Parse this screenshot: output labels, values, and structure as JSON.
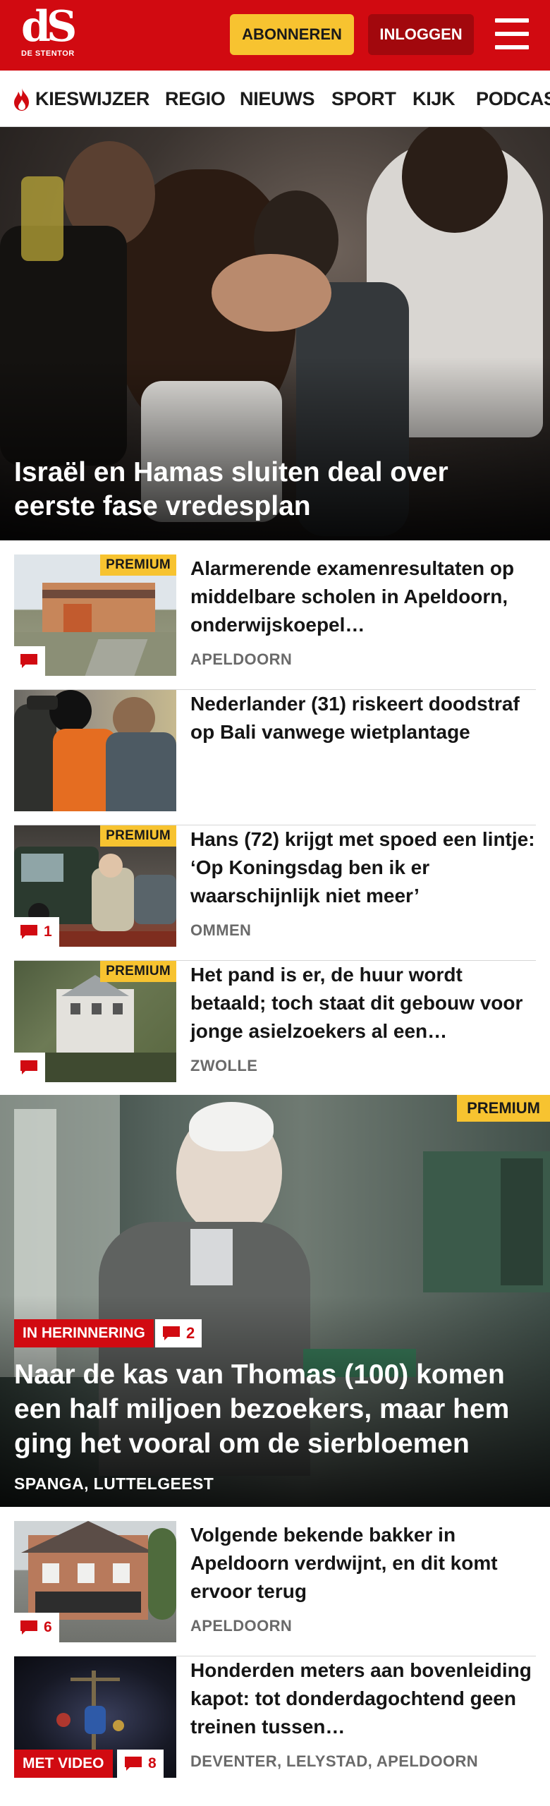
{
  "header": {
    "logo_text": "dS",
    "logo_subtitle": "DE STENTOR",
    "subscribe_label": "ABONNEREN",
    "login_label": "INLOGGEN",
    "menu_icon": "hamburger-menu-icon",
    "brand_color": "#d10a11",
    "accent_color": "#f7c330"
  },
  "nav": {
    "items": [
      {
        "label": "KIESWIJZER",
        "icon": "flame-icon"
      },
      {
        "label": "REGIO"
      },
      {
        "label": "NIEUWS"
      },
      {
        "label": "SPORT"
      },
      {
        "label": "KIJK"
      },
      {
        "label": "PODCAST"
      }
    ]
  },
  "hero": {
    "title": "Israël en Hamas sluiten deal over eerste fase vredesplan"
  },
  "articles": [
    {
      "title": "Alarmerende examenresultaten op middelbare scholen in Apeldoorn, onderwijskoepel…",
      "location": "APELDOORN",
      "premium": "PREMIUM",
      "comments": ""
    },
    {
      "title": "Nederlander (31) riskeert doodstraf op Bali vanwege wietplantage",
      "location": "",
      "premium": "",
      "comments": ""
    },
    {
      "title": "Hans (72) krijgt met spoed een lintje: ‘Op Koningsdag ben ik er waarschijnlijk niet meer’",
      "location": "OMMEN",
      "premium": "PREMIUM",
      "comments": "1"
    },
    {
      "title": "Het pand is er, de huur wordt betaald; toch staat dit gebouw voor jonge asielzoekers al een…",
      "location": "ZWOLLE",
      "premium": "PREMIUM",
      "comments": ""
    }
  ],
  "feature": {
    "premium": "PREMIUM",
    "tag": "IN HERINNERING",
    "comments": "2",
    "title": "Naar de kas van Thomas (100) komen een half miljoen bezoekers, maar hem ging het vooral om de sierbloemen",
    "location": "SPANGA, LUTTELGEEST"
  },
  "articles_bottom": [
    {
      "title": "Volgende bekende bakker in Apeldoorn verdwijnt, en dit komt ervoor terug",
      "location": "APELDOORN",
      "comments": "6"
    },
    {
      "title": "Honderden meters aan bovenlei­ding kapot: tot donderdagoch­tend geen treinen tussen…",
      "location": "DEVENTER, LELYSTAD, APELDOORN",
      "video_tag": "MET VIDEO",
      "comments": "8"
    }
  ]
}
